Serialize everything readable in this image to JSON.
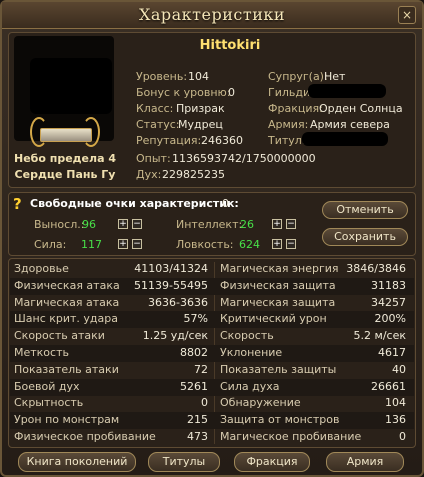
{
  "window": {
    "title": "Характеристики",
    "close_label": "×"
  },
  "character": {
    "name": "Hittokiri",
    "hero_line1": "Небо предела 4",
    "hero_line2": "Сердце Пань Гу",
    "info_left": [
      {
        "label": "Уровень:",
        "value": "104"
      },
      {
        "label": "Бонус к уровню:",
        "value": "0"
      },
      {
        "label": "Класс:",
        "value": "Призрак"
      },
      {
        "label": "Статус:",
        "value": "Мудрец"
      },
      {
        "label": "Репутация:",
        "value": "246360"
      }
    ],
    "info_right": [
      {
        "label": "Супруг(а):",
        "value": "Нет"
      },
      {
        "label": "Гильдия",
        "value": ""
      },
      {
        "label": "Фракция:",
        "value": "Орден Солнца"
      },
      {
        "label": "Армия:",
        "value": "Армия севера"
      },
      {
        "label": "Титул:",
        "value": ""
      }
    ],
    "exp_label": "Опыт:",
    "exp_value": "1136593742/1750000000",
    "spirit_label": "Дух:",
    "spirit_value": "229825235"
  },
  "points": {
    "free_label": "Свободные очки характеристик:",
    "free_value": "0",
    "stats": [
      {
        "label": "Выносл.:",
        "value": "96"
      },
      {
        "label": "Интеллект:",
        "value": "26"
      },
      {
        "label": "Сила:",
        "value": "117"
      },
      {
        "label": "Ловкость:",
        "value": "624"
      }
    ],
    "plus": "+",
    "minus": "−",
    "cancel_label": "Отменить",
    "save_label": "Сохранить"
  },
  "attributes": [
    {
      "l_name": "Здоровье",
      "l_val": "41103/41324",
      "r_name": "Магическая энергия",
      "r_val": "3846/3846"
    },
    {
      "l_name": "Физическая атака",
      "l_val": "51139-55495",
      "r_name": "Физическая защита",
      "r_val": "31183"
    },
    {
      "l_name": "Магическая атака",
      "l_val": "3636-3636",
      "r_name": "Магическая защита",
      "r_val": "34257"
    },
    {
      "l_name": "Шанс крит. удара",
      "l_val": "57%",
      "r_name": "Критический урон",
      "r_val": "200%"
    },
    {
      "l_name": "Скорость атаки",
      "l_val": "1.25 уд/сек",
      "r_name": "Скорость",
      "r_val": "5.2 м/сек"
    },
    {
      "l_name": "Меткость",
      "l_val": "8802",
      "r_name": "Уклонение",
      "r_val": "4617"
    },
    {
      "l_name": "Показатель атаки",
      "l_val": "72",
      "r_name": "Показатель защиты",
      "r_val": "40"
    },
    {
      "l_name": "Боевой дух",
      "l_val": "5261",
      "r_name": "Сила духа",
      "r_val": "26661"
    },
    {
      "l_name": "Скрытность",
      "l_val": "0",
      "r_name": "Обнаружение",
      "r_val": "104"
    },
    {
      "l_name": "Урон по монстрам",
      "l_val": "215",
      "r_name": "Защита от монстров",
      "r_val": "136"
    },
    {
      "l_name": "Физическое пробивание",
      "l_val": "473",
      "r_name": "Магическое пробивание",
      "r_val": "0"
    }
  ],
  "bottom_buttons": [
    "Книга поколений",
    "Титулы",
    "Фракция",
    "Армия"
  ]
}
